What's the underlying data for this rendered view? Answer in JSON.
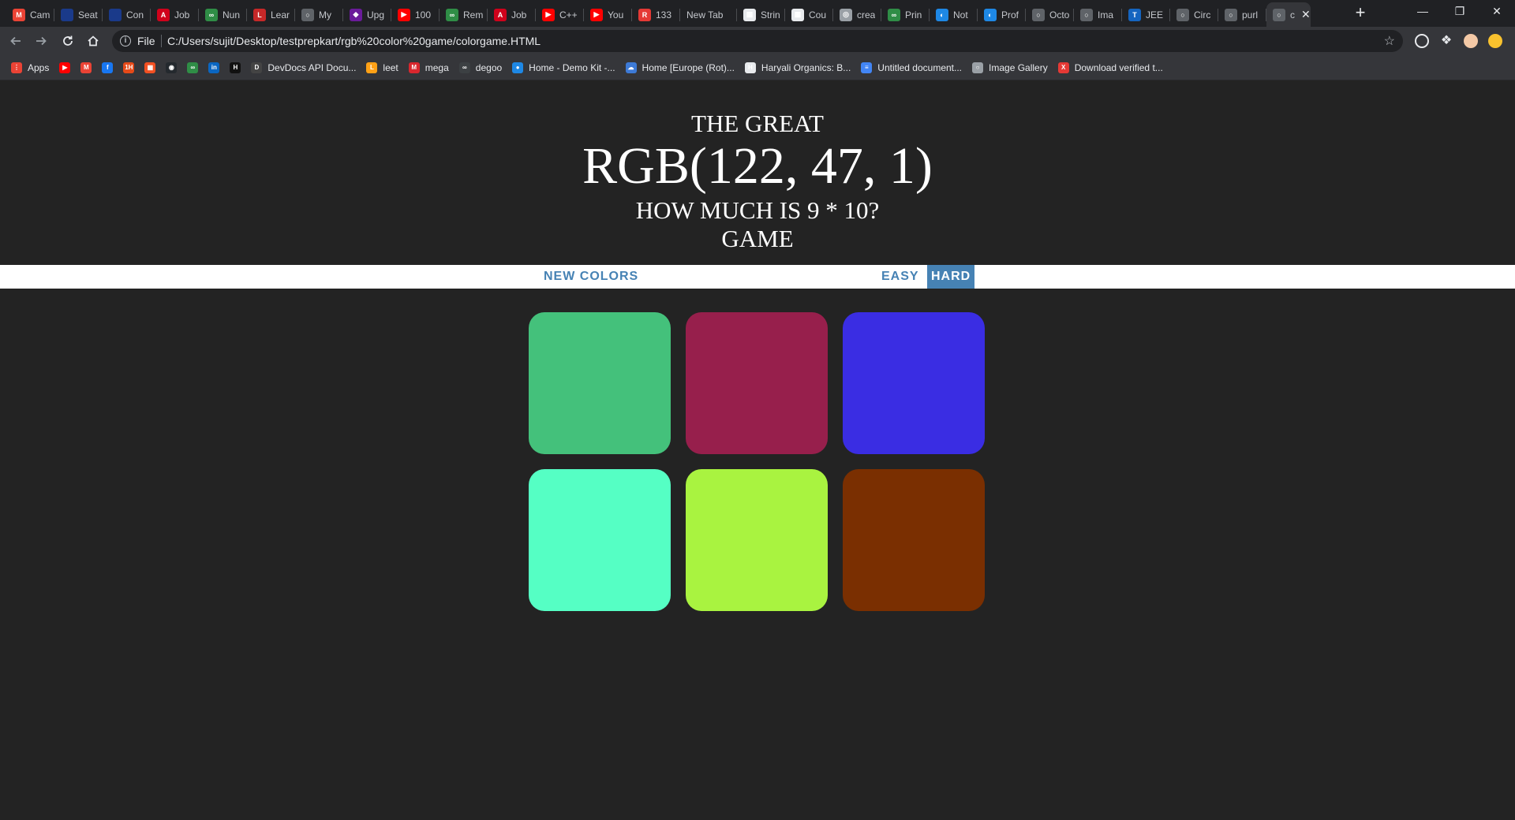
{
  "browser": {
    "tabs": [
      {
        "title": "Cam",
        "icon": "gmail-icon",
        "color": "#ea4335",
        "glyph": "M"
      },
      {
        "title": "Seat",
        "icon": "doc-icon",
        "color": "#1a3a8a",
        "glyph": ""
      },
      {
        "title": "Con",
        "icon": "doc-icon",
        "color": "#1a3a8a",
        "glyph": ""
      },
      {
        "title": "Job",
        "icon": "aow-icon",
        "color": "#d0021b",
        "glyph": "A"
      },
      {
        "title": "Nun",
        "icon": "gfg-icon",
        "color": "#2f8d46",
        "glyph": "∞"
      },
      {
        "title": "Lear",
        "icon": "book-icon",
        "color": "#c62828",
        "glyph": "L"
      },
      {
        "title": "My",
        "icon": "globe-icon",
        "color": "#5f6368",
        "glyph": "○"
      },
      {
        "title": "Upg",
        "icon": "upgrad-icon",
        "color": "#6a1b9a",
        "glyph": "◆"
      },
      {
        "title": "100",
        "icon": "youtube-icon",
        "color": "#ff0000",
        "glyph": "▶"
      },
      {
        "title": "Rem",
        "icon": "gfg-icon",
        "color": "#2f8d46",
        "glyph": "∞"
      },
      {
        "title": "Job",
        "icon": "aow-icon",
        "color": "#d0021b",
        "glyph": "A"
      },
      {
        "title": "C++",
        "icon": "youtube-icon",
        "color": "#ff0000",
        "glyph": "▶"
      },
      {
        "title": "You",
        "icon": "youtube-icon",
        "color": "#ff0000",
        "glyph": "▶"
      },
      {
        "title": "133",
        "icon": "r-icon",
        "color": "#e53935",
        "glyph": "R"
      },
      {
        "title": "New Tab",
        "icon": "",
        "color": "",
        "glyph": ""
      },
      {
        "title": "Strin",
        "icon": "page-icon",
        "color": "#e8eaed",
        "glyph": "▦"
      },
      {
        "title": "Cou",
        "icon": "page-icon",
        "color": "#e8eaed",
        "glyph": "▦"
      },
      {
        "title": "crea",
        "icon": "incognito-icon",
        "color": "#9aa0a6",
        "glyph": "◎"
      },
      {
        "title": "Prin",
        "icon": "gfg-icon",
        "color": "#2f8d46",
        "glyph": "∞"
      },
      {
        "title": "Not",
        "icon": "edge-icon",
        "color": "#1e88e5",
        "glyph": "◐"
      },
      {
        "title": "Prof",
        "icon": "edge-icon",
        "color": "#1e88e5",
        "glyph": "◐"
      },
      {
        "title": "Octo",
        "icon": "globe-icon",
        "color": "#5f6368",
        "glyph": "○"
      },
      {
        "title": "Ima",
        "icon": "globe-icon",
        "color": "#5f6368",
        "glyph": "○"
      },
      {
        "title": "JEE",
        "icon": "jee-icon",
        "color": "#1565c0",
        "glyph": "T"
      },
      {
        "title": "Circ",
        "icon": "globe-icon",
        "color": "#5f6368",
        "glyph": "○"
      },
      {
        "title": "purl",
        "icon": "globe-icon",
        "color": "#5f6368",
        "glyph": "○"
      },
      {
        "title": "c",
        "icon": "globe-icon",
        "color": "#5f6368",
        "glyph": "○",
        "active": true
      }
    ],
    "scheme": "File",
    "url": "C:/Users/sujit/Desktop/testprepkart/rgb%20color%20game/colorgame.HTML",
    "bookmarks": [
      {
        "label": "Apps",
        "icon": "apps-icon",
        "color": "#ea4335",
        "glyph": "⋮"
      },
      {
        "label": "",
        "icon": "youtube-icon",
        "color": "#ff0000",
        "glyph": "▶"
      },
      {
        "label": "",
        "icon": "gmail-icon",
        "color": "#ea4335",
        "glyph": "M"
      },
      {
        "label": "",
        "icon": "facebook-icon",
        "color": "#1877f2",
        "glyph": "f"
      },
      {
        "label": "",
        "icon": "1h-icon",
        "color": "#e64a19",
        "glyph": "1H"
      },
      {
        "label": "",
        "icon": "microsoft-icon",
        "color": "#f25022",
        "glyph": "▦"
      },
      {
        "label": "",
        "icon": "github-icon",
        "color": "#24292e",
        "glyph": "◉"
      },
      {
        "label": "",
        "icon": "gfg-icon",
        "color": "#2f8d46",
        "glyph": "∞"
      },
      {
        "label": "",
        "icon": "linkedin-icon",
        "color": "#0a66c2",
        "glyph": "in"
      },
      {
        "label": "",
        "icon": "hackerrank-icon",
        "color": "#111111",
        "glyph": "H"
      },
      {
        "label": "DevDocs API Docu...",
        "icon": "devdocs-icon",
        "color": "#444444",
        "glyph": "D"
      },
      {
        "label": "leet",
        "icon": "leetcode-icon",
        "color": "#ffa116",
        "glyph": "L"
      },
      {
        "label": "mega",
        "icon": "mega-icon",
        "color": "#d9272e",
        "glyph": "M"
      },
      {
        "label": "degoo",
        "icon": "degoo-icon",
        "color": "#3c4043",
        "glyph": "∞"
      },
      {
        "label": "Home - Demo Kit -...",
        "icon": "demokit-icon",
        "color": "#1e88e5",
        "glyph": "●"
      },
      {
        "label": "Home [Europe (Rot)...",
        "icon": "cloud-icon",
        "color": "#3d7ad6",
        "glyph": "☁"
      },
      {
        "label": "Haryali Organics: B...",
        "icon": "haryali-icon",
        "color": "#e8eaed",
        "glyph": "H"
      },
      {
        "label": "Untitled document...",
        "icon": "docs-icon",
        "color": "#4285f4",
        "glyph": "≡"
      },
      {
        "label": "Image Gallery",
        "icon": "globe-icon",
        "color": "#9aa0a6",
        "glyph": "○"
      },
      {
        "label": "Download verified t...",
        "icon": "x-icon",
        "color": "#e53935",
        "glyph": "X"
      }
    ]
  },
  "game": {
    "line1": "THE GREAT",
    "rgb_display": "RGB(122, 47, 1)",
    "question": "HOW MUCH IS 9 * 10?",
    "line4": "GAME",
    "new_colors_label": "NEW COLORS",
    "easy_label": "EASY",
    "hard_label": "HARD",
    "selected_mode": "hard",
    "squares": [
      "#44c17b",
      "#971f4c",
      "#3a2de3",
      "#55ffc4",
      "#a9f340",
      "#7a2f01"
    ]
  }
}
